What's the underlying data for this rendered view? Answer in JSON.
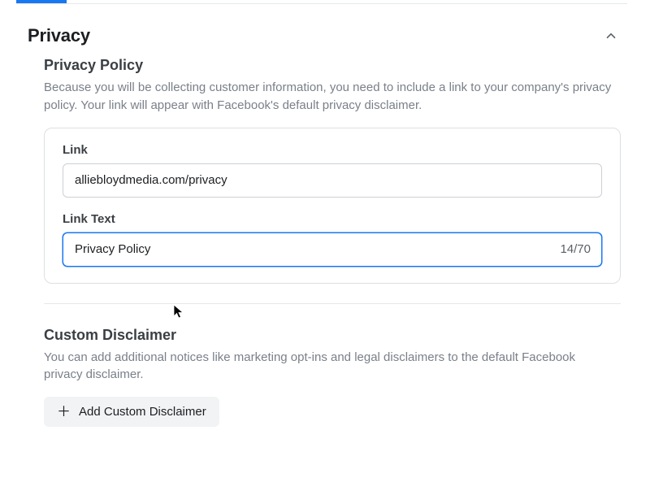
{
  "section": {
    "title": "Privacy"
  },
  "privacyPolicy": {
    "heading": "Privacy Policy",
    "description": "Because you will be collecting customer information, you need to include a link to your company's privacy policy. Your link will appear with Facebook's default privacy disclaimer.",
    "linkLabel": "Link",
    "linkValue": "alliebloydmedia.com/privacy",
    "linkTextLabel": "Link Text",
    "linkTextValue": "Privacy Policy",
    "charCount": "14/70"
  },
  "customDisclaimer": {
    "heading": "Custom Disclaimer",
    "description": "You can add additional notices like marketing opt-ins and legal disclaimers to the default Facebook privacy disclaimer.",
    "addButton": "Add Custom Disclaimer"
  }
}
